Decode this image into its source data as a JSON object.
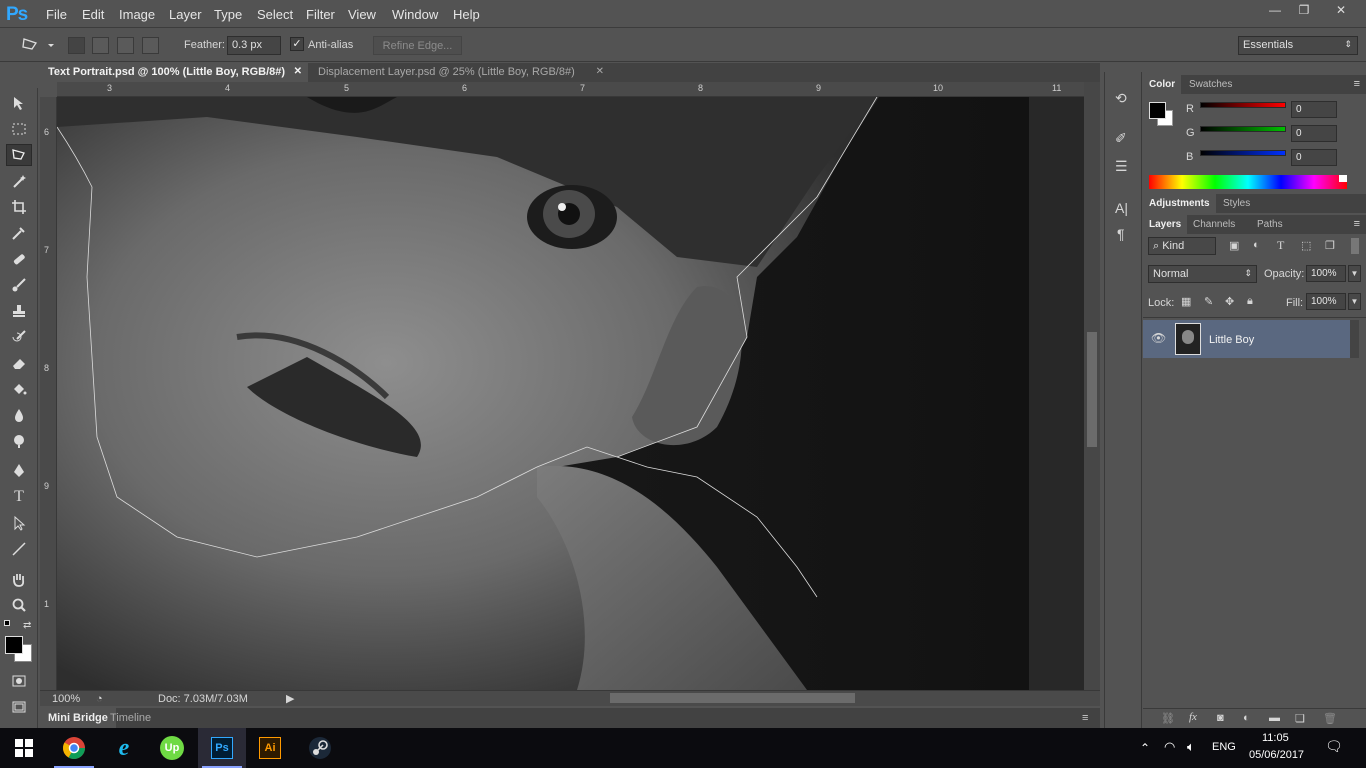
{
  "app": {
    "logo": "Ps"
  },
  "menu": [
    "File",
    "Edit",
    "Image",
    "Layer",
    "Type",
    "Select",
    "Filter",
    "View",
    "Window",
    "Help"
  ],
  "window_controls": {
    "minimize": "—",
    "restore": "❐",
    "close": "✕"
  },
  "options": {
    "feather_label": "Feather:",
    "feather_value": "0.3 px",
    "antialias_label": "Anti-alias",
    "antialias_checked": true,
    "refine_edge": "Refine Edge...",
    "workspace": "Essentials"
  },
  "tabs": [
    {
      "label": "Text Portrait.psd @ 100% (Little Boy, RGB/8#)",
      "active": true
    },
    {
      "label": "Displacement Layer.psd @ 25% (Little Boy, RGB/8#)",
      "active": false
    }
  ],
  "ruler_top": [
    "3",
    "4",
    "5",
    "6",
    "7",
    "8",
    "9",
    "10",
    "11"
  ],
  "ruler_left": [
    "6",
    "7",
    "8",
    "9",
    "1"
  ],
  "status": {
    "zoom": "100%",
    "doc": "Doc: 7.03M/7.03M"
  },
  "bottom_tabs": [
    "Mini Bridge",
    "Timeline"
  ],
  "color_panel": {
    "tabs": [
      "Color",
      "Swatches"
    ],
    "r_label": "R",
    "g_label": "G",
    "b_label": "B",
    "r": "0",
    "g": "0",
    "b": "0",
    "accent_r": "#ff0000",
    "accent_g": "#00c000",
    "accent_b": "#0030ff"
  },
  "adjust_tabs": [
    "Adjustments",
    "Styles"
  ],
  "layers_panel": {
    "tabs": [
      "Layers",
      "Channels",
      "Paths"
    ],
    "kind": "Kind",
    "blend_mode": "Normal",
    "opacity_label": "Opacity:",
    "opacity": "100%",
    "lock_label": "Lock:",
    "fill_label": "Fill:",
    "fill": "100%",
    "layers": [
      {
        "name": "Little Boy",
        "visible": true,
        "selected": true
      }
    ]
  },
  "taskbar": {
    "apps": [
      "chrome",
      "ie",
      "upwork",
      "photoshop",
      "illustrator",
      "steam"
    ],
    "upwork_label": "Up",
    "ps_label": "Ps",
    "ai_label": "Ai",
    "lang": "ENG",
    "time": "11:05",
    "date": "05/06/2017"
  }
}
